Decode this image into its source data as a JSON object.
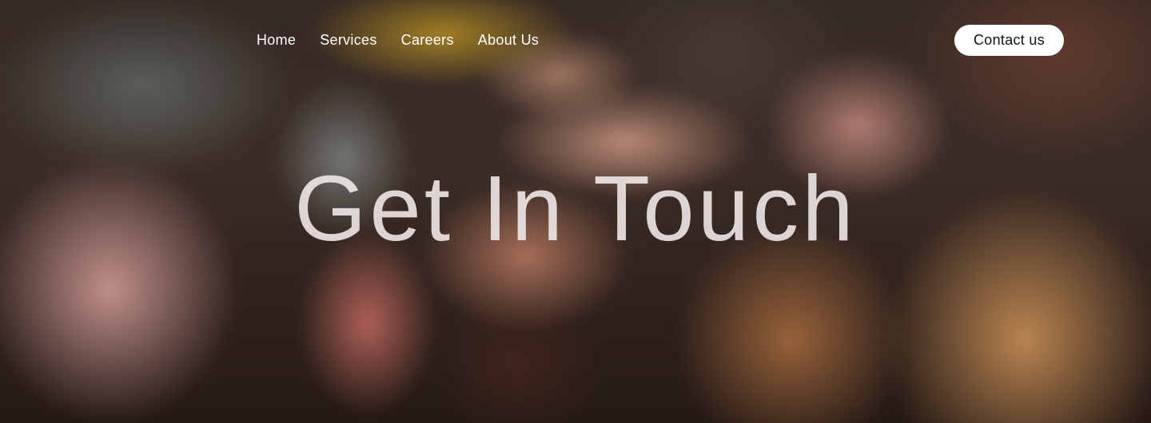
{
  "nav": {
    "links": [
      {
        "label": "Home"
      },
      {
        "label": "Services"
      },
      {
        "label": "Careers"
      },
      {
        "label": "About Us"
      }
    ],
    "contact_label": "Contact us"
  },
  "hero": {
    "title": "Get In Touch",
    "background_image": "stacked-hands-photo"
  },
  "colors": {
    "button_bg": "#ffffff",
    "button_text": "#111111",
    "nav_text": "#ffffff",
    "title_text": "#eee8e8"
  }
}
